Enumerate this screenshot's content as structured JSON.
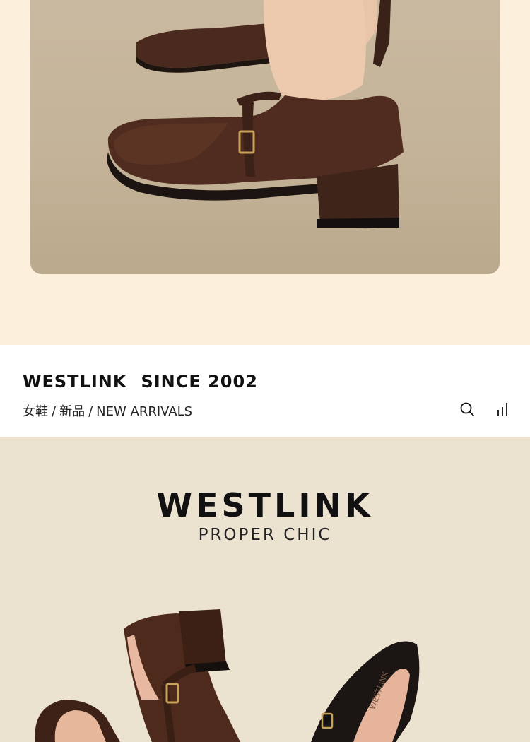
{
  "hero": {
    "image_alt": "brown-leather-mary-jane-heels-photo"
  },
  "brand_bar": {
    "brand": "WESTLINK",
    "since": "SINCE 2002",
    "breadcrumb": {
      "category": "女鞋",
      "separator": "/",
      "subcategory": "新品",
      "label": "NEW ARRIVALS"
    },
    "icons": [
      "search-icon",
      "bar-chart-icon"
    ]
  },
  "feature": {
    "logo": "WESTLINK",
    "tagline": "PROPER CHIC",
    "shoe_insole_text": "WESTLINK"
  },
  "colors": {
    "cream": "#fcf0dd",
    "white": "#ffffff",
    "beige": "#ece2d0",
    "brown_leather": "#4a2a1e",
    "text": "#111111"
  }
}
